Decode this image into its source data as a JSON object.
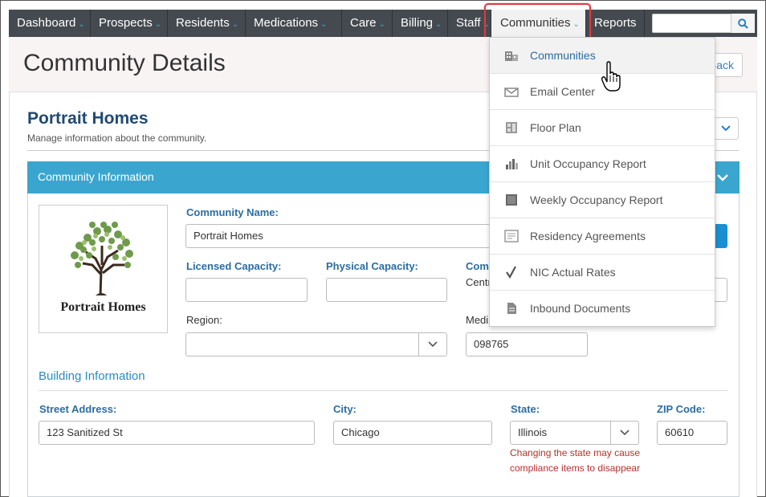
{
  "nav": {
    "items": [
      {
        "label": "Dashboard",
        "chevron": "˅"
      },
      {
        "label": "Prospects",
        "chevron": "˅"
      },
      {
        "label": "Residents",
        "chevron": "˅"
      },
      {
        "label": "Medications",
        "chevron": "˅"
      },
      {
        "label": "Care",
        "chevron": "˅"
      },
      {
        "label": "Billing",
        "chevron": "˅"
      },
      {
        "label": "Staff",
        "chevron": "˅"
      },
      {
        "label": "Communities",
        "chevron": "˅"
      },
      {
        "label": "Reports",
        "chevron": ""
      }
    ],
    "active": "Communities",
    "search_placeholder": ""
  },
  "header": {
    "title": "Community Details",
    "back_label": "Back"
  },
  "community": {
    "name": "Portrait Homes",
    "description": "Manage information about the community.",
    "logo_text": "Portrait Homes"
  },
  "panel": {
    "title": "Community Information"
  },
  "form": {
    "community_name_label": "Community Name:",
    "community_name_value": "Portrait Homes",
    "licensed_capacity_label": "Licensed Capacity:",
    "licensed_capacity_value": "",
    "physical_capacity_label": "Physical Capacity:",
    "physical_capacity_value": "",
    "comm_label_partial": "Com",
    "comm_value_partial": "Centr",
    "region_label": "Region:",
    "region_value": "",
    "medi_label_partial": "Medi",
    "medi_value": "098765"
  },
  "building": {
    "title": "Building Information",
    "street_label": "Street Address:",
    "street_value": "123 Sanitized St",
    "city_label": "City:",
    "city_value": "Chicago",
    "state_label": "State:",
    "state_value": "Illinois",
    "zip_label": "ZIP Code:",
    "zip_value": "60610",
    "state_warning": "Changing the state may cause compliance items to disappear"
  },
  "dropdown": {
    "items": [
      {
        "label": "Communities",
        "icon": "building-icon"
      },
      {
        "label": "Email Center",
        "icon": "envelope-icon"
      },
      {
        "label": "Floor Plan",
        "icon": "floor-plan-icon"
      },
      {
        "label": "Unit Occupancy Report",
        "icon": "bar-chart-icon"
      },
      {
        "label": "Weekly Occupancy Report",
        "icon": "report-icon"
      },
      {
        "label": "Residency Agreements",
        "icon": "document-icon"
      },
      {
        "label": "NIC Actual Rates",
        "icon": "checkmark-icon"
      },
      {
        "label": "Inbound Documents",
        "icon": "inbound-document-icon"
      }
    ]
  },
  "colors": {
    "navbar": "#444a50",
    "panel_header": "#3aa6cf",
    "highlight": "#e0393e",
    "title_blue": "#1f4a72",
    "label_blue": "#2a6da3",
    "warning": "#b3312d"
  }
}
